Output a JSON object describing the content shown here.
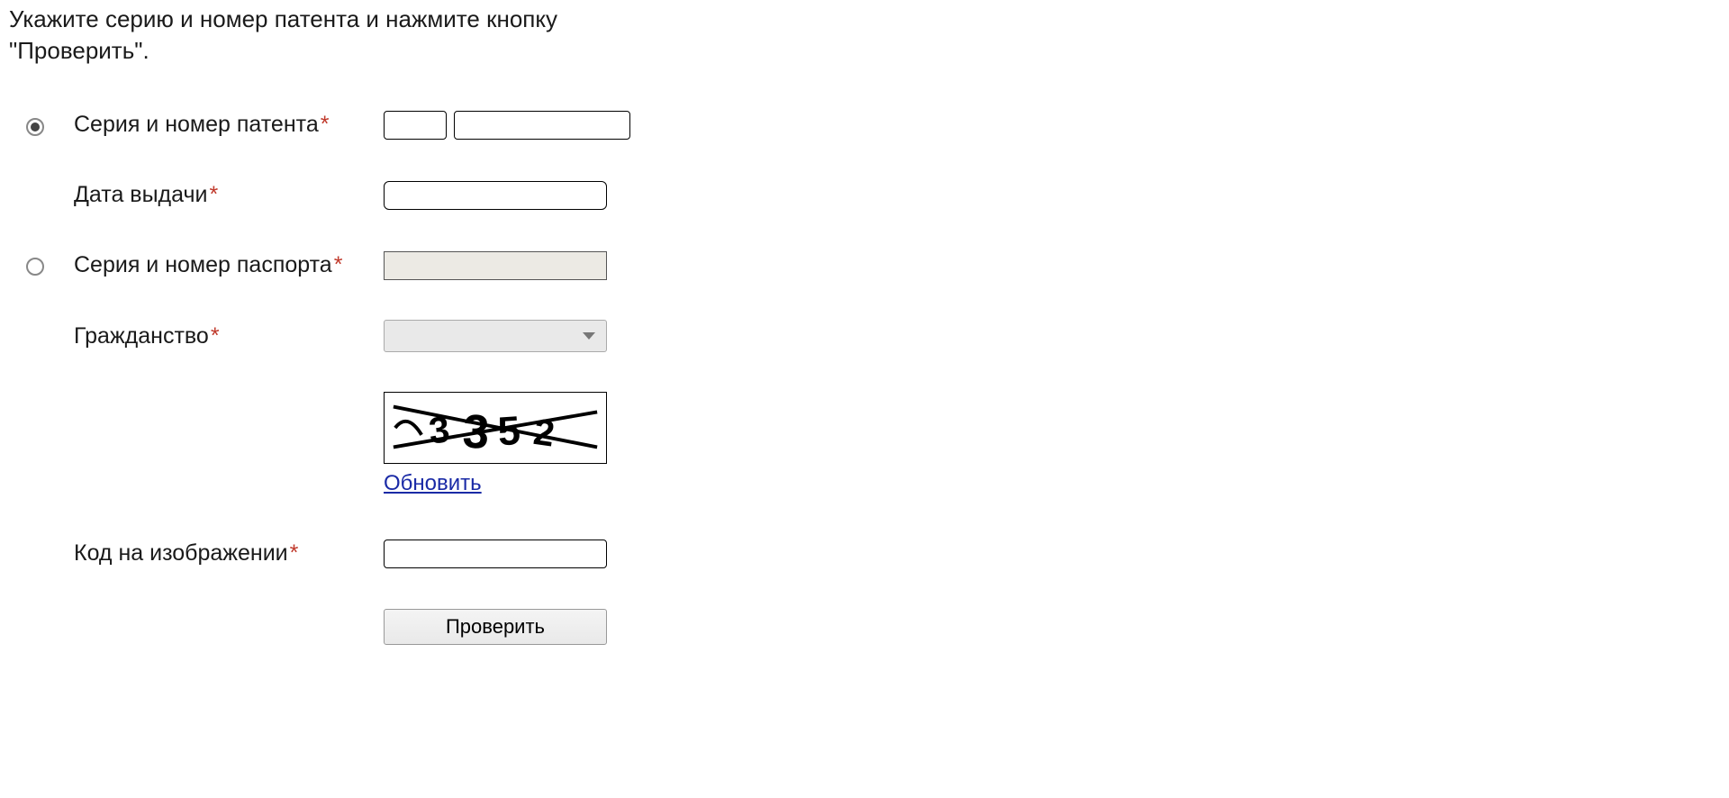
{
  "intro": "Укажите серию и номер патента и нажмите кнопку \"Проверить\".",
  "form": {
    "patent_label": "Серия и номер патента",
    "patent_series_value": "",
    "patent_number_value": "",
    "date_label": "Дата выдачи",
    "date_value": "",
    "passport_label": "Серия и номер паспорта",
    "passport_value": "",
    "citizenship_label": "Гражданство",
    "citizenship_value": "",
    "captcha_refresh": "Обновить",
    "captcha_label": "Код на изображении",
    "captcha_value": "",
    "submit": "Проверить"
  },
  "required_marker": "*"
}
